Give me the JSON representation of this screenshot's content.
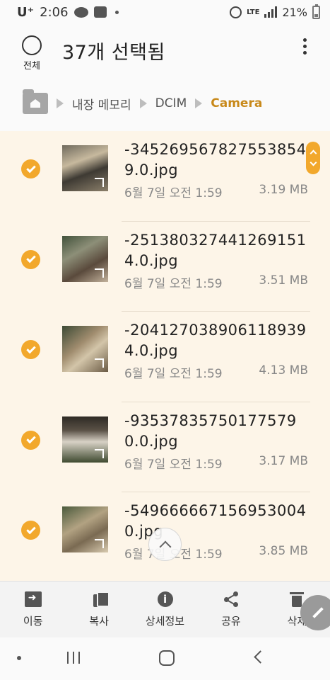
{
  "status_bar": {
    "carrier": "U⁺",
    "time": "2:06",
    "network": "LTE",
    "battery": "21%"
  },
  "header": {
    "select_all_label": "전체",
    "title": "37개 선택됨"
  },
  "breadcrumb": {
    "items": [
      "내장 메모리",
      "DCIM",
      "Camera"
    ]
  },
  "files": [
    {
      "name": "-3452695678275538549.0.jpg",
      "date": "6월 7일 오전 1:59",
      "size": "3.19 MB",
      "selected": true
    },
    {
      "name": "-2513803274412691514.0.jpg",
      "date": "6월 7일 오전 1:59",
      "size": "3.51 MB",
      "selected": true
    },
    {
      "name": "-2041270389061189394.0.jpg",
      "date": "6월 7일 오전 1:59",
      "size": "4.13 MB",
      "selected": true
    },
    {
      "name": "-935378357501775790.0.jpg",
      "date": "6월 7일 오전 1:59",
      "size": "3.17 MB",
      "selected": true
    },
    {
      "name": "-5496666671569530040.jpg",
      "date": "6월 7일 오전 1:59",
      "size": "3.85 MB",
      "selected": true
    }
  ],
  "actions": [
    {
      "label": "이동",
      "icon": "move-icon"
    },
    {
      "label": "복사",
      "icon": "copy-icon"
    },
    {
      "label": "상세정보",
      "icon": "info-icon"
    },
    {
      "label": "공유",
      "icon": "share-icon"
    },
    {
      "label": "삭제",
      "icon": "delete-icon"
    }
  ],
  "colors": {
    "accent": "#f2a82c",
    "selected_row_bg": "#fdf5e8",
    "active_crumb": "#c8891a"
  }
}
